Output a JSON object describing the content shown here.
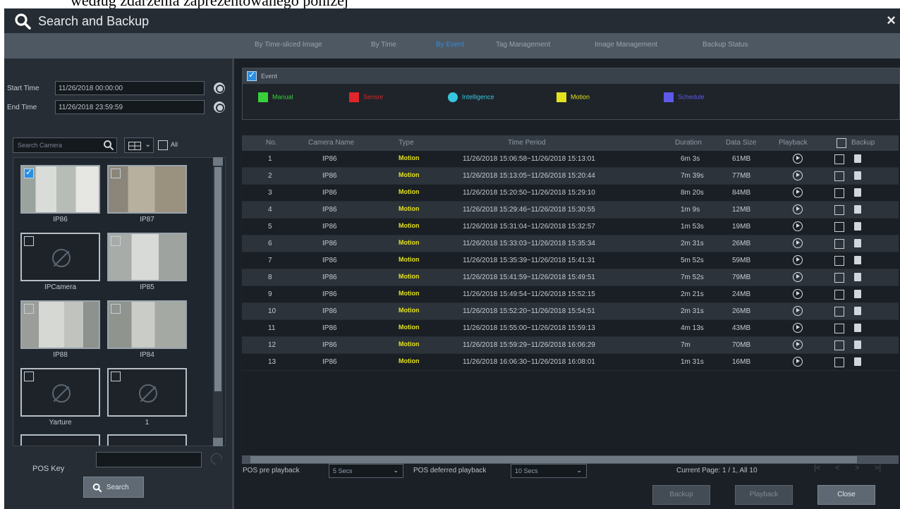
{
  "caption": "według zdarzenia zaprezentowanego poniżej",
  "window": {
    "title": "Search and Backup",
    "close_label": "×"
  },
  "tabs": [
    {
      "label": "By Time-sliced Image",
      "active": false
    },
    {
      "label": "By Time",
      "active": false
    },
    {
      "label": "By Event",
      "active": true
    },
    {
      "label": "Tag Management",
      "active": false
    },
    {
      "label": "Image Management",
      "active": false
    },
    {
      "label": "Backup Status",
      "active": false
    }
  ],
  "left": {
    "start_time_label": "Start Time",
    "start_time_value": "11/26/2018 00:00:00",
    "end_time_label": "End Time",
    "end_time_value": "11/26/2018 23:59:59",
    "search_camera_placeholder": "Search Camera",
    "all_label": "All",
    "cameras": [
      {
        "name": "IP86",
        "checked": true,
        "has_image": true
      },
      {
        "name": "IP87",
        "checked": false,
        "has_image": true
      },
      {
        "name": "IPCamera",
        "checked": false,
        "has_image": false
      },
      {
        "name": "IP85",
        "checked": false,
        "has_image": true
      },
      {
        "name": "IP88",
        "checked": false,
        "has_image": true
      },
      {
        "name": "IP84",
        "checked": false,
        "has_image": true
      },
      {
        "name": "Yarture",
        "checked": false,
        "has_image": false
      },
      {
        "name": "1",
        "checked": false,
        "has_image": false
      }
    ],
    "pos_key_label": "POS Key",
    "search_button": "Search"
  },
  "events": {
    "header": "Event",
    "items": [
      {
        "label": "Manual",
        "color": "#39d13a",
        "icon": "manual-icon"
      },
      {
        "label": "Sensor",
        "color": "#e0262a",
        "icon": "sensor-icon"
      },
      {
        "label": "Intelligence",
        "color": "#36c7e0",
        "icon": "intelligence-icon"
      },
      {
        "label": "Motion",
        "color": "#e4e21e",
        "icon": "motion-icon"
      },
      {
        "label": "Schedule",
        "color": "#5d5ae8",
        "icon": "schedule-icon"
      }
    ]
  },
  "table": {
    "columns": [
      "No.",
      "Camera Name",
      "Type",
      "Time Period",
      "Duration",
      "Data Size",
      "Playback",
      "Backup"
    ],
    "rows": [
      {
        "no": "1",
        "camera": "IP86",
        "type": "Motion",
        "period": "11/26/2018 15:06:58~11/26/2018 15:13:01",
        "duration": "6m 3s",
        "size": "61MB"
      },
      {
        "no": "2",
        "camera": "IP86",
        "type": "Motion",
        "period": "11/26/2018 15:13:05~11/26/2018 15:20:44",
        "duration": "7m 39s",
        "size": "77MB"
      },
      {
        "no": "3",
        "camera": "IP86",
        "type": "Motion",
        "period": "11/26/2018 15:20:50~11/26/2018 15:29:10",
        "duration": "8m 20s",
        "size": "84MB"
      },
      {
        "no": "4",
        "camera": "IP86",
        "type": "Motion",
        "period": "11/26/2018 15:29:46~11/26/2018 15:30:55",
        "duration": "1m 9s",
        "size": "12MB"
      },
      {
        "no": "5",
        "camera": "IP86",
        "type": "Motion",
        "period": "11/26/2018 15:31:04~11/26/2018 15:32:57",
        "duration": "1m 53s",
        "size": "19MB"
      },
      {
        "no": "6",
        "camera": "IP86",
        "type": "Motion",
        "period": "11/26/2018 15:33:03~11/26/2018 15:35:34",
        "duration": "2m 31s",
        "size": "26MB"
      },
      {
        "no": "7",
        "camera": "IP86",
        "type": "Motion",
        "period": "11/26/2018 15:35:39~11/26/2018 15:41:31",
        "duration": "5m 52s",
        "size": "59MB"
      },
      {
        "no": "8",
        "camera": "IP86",
        "type": "Motion",
        "period": "11/26/2018 15:41:59~11/26/2018 15:49:51",
        "duration": "7m 52s",
        "size": "79MB"
      },
      {
        "no": "9",
        "camera": "IP86",
        "type": "Motion",
        "period": "11/26/2018 15:49:54~11/26/2018 15:52:15",
        "duration": "2m 21s",
        "size": "24MB"
      },
      {
        "no": "10",
        "camera": "IP86",
        "type": "Motion",
        "period": "11/26/2018 15:52:20~11/26/2018 15:54:51",
        "duration": "2m 31s",
        "size": "26MB"
      },
      {
        "no": "11",
        "camera": "IP86",
        "type": "Motion",
        "period": "11/26/2018 15:55:00~11/26/2018 15:59:13",
        "duration": "4m 13s",
        "size": "43MB"
      },
      {
        "no": "12",
        "camera": "IP86",
        "type": "Motion",
        "period": "11/26/2018 15:59:29~11/26/2018 16:06:29",
        "duration": "7m",
        "size": "70MB"
      },
      {
        "no": "13",
        "camera": "IP86",
        "type": "Motion",
        "period": "11/26/2018 16:06:30~11/26/2018 16:08:01",
        "duration": "1m 31s",
        "size": "16MB"
      }
    ]
  },
  "footer": {
    "pos_pre_label": "POS pre playback",
    "pos_pre_value": "5 Secs",
    "pos_deferred_label": "POS deferred playback",
    "pos_deferred_value": "10 Secs",
    "page_info": "Current Page: 1 / 1, All 10",
    "page_nav": [
      "|<",
      "<",
      ">",
      ">|"
    ],
    "backup_button": "Backup",
    "playback_button": "Playback",
    "close_button": "Close"
  }
}
